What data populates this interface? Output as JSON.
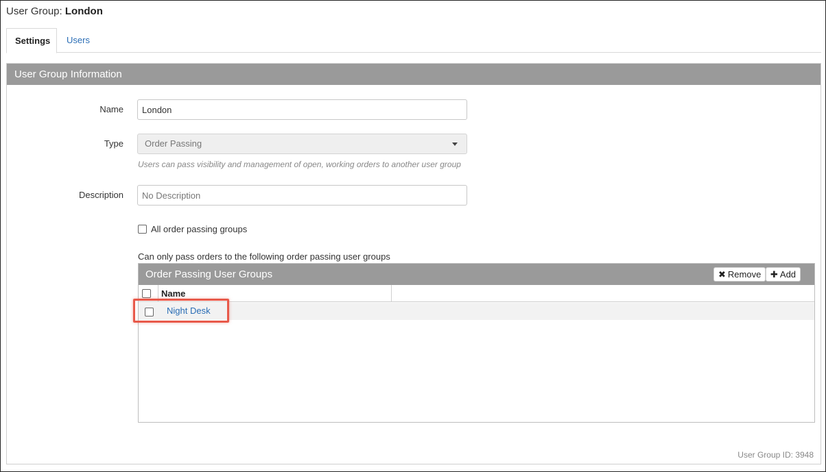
{
  "page": {
    "title_prefix": "User Group: ",
    "title_name": "London"
  },
  "tabs": [
    {
      "label": "Settings",
      "active": true
    },
    {
      "label": "Users",
      "active": false
    }
  ],
  "panel": {
    "title": "User Group Information",
    "fields": {
      "name_label": "Name",
      "name_value": "London",
      "type_label": "Type",
      "type_value": "Order Passing",
      "type_hint": "Users can pass visibility and management of open, working orders to another user group",
      "description_label": "Description",
      "description_placeholder": "No Description"
    },
    "all_groups_label": "All order passing groups",
    "all_groups_checked": false,
    "restrict_caption": "Can only pass orders to the following order passing user groups"
  },
  "grid": {
    "title": "Order Passing User Groups",
    "remove_label": "Remove",
    "add_label": "Add",
    "column_name": "Name",
    "rows": [
      {
        "name": "Night Desk",
        "checked": false
      }
    ]
  },
  "footer": {
    "id_text": "User Group ID: 3948"
  },
  "colors": {
    "header_gray": "#9a9a9a",
    "link_blue": "#2a6db5",
    "highlight_red": "#e8594a"
  }
}
